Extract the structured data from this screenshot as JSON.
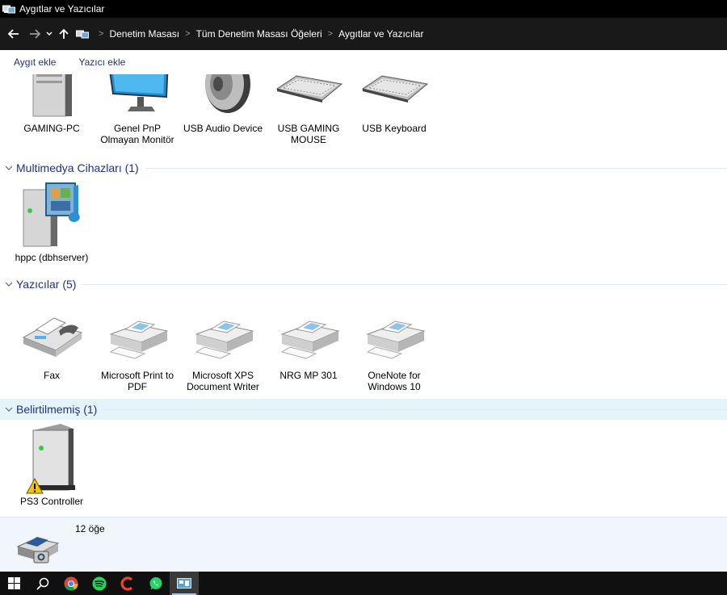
{
  "window": {
    "title": "Aygıtlar ve Yazıcılar"
  },
  "address_bar": {
    "breadcrumbs": [
      "Denetim Masası",
      "Tüm Denetim Masası Öğeleri",
      "Aygıtlar ve Yazıcılar"
    ]
  },
  "toolbar": {
    "add_device_label": "Aygıt ekle",
    "add_printer_label": "Yazıcı ekle"
  },
  "devices": {
    "items": [
      {
        "label": "GAMING-PC",
        "icon": "computer-icon"
      },
      {
        "label": "Genel PnP Olmayan Monitör",
        "icon": "monitor-icon"
      },
      {
        "label": "USB Audio Device",
        "icon": "speaker-icon"
      },
      {
        "label": "USB GAMING MOUSE",
        "icon": "keyboard-icon"
      },
      {
        "label": "USB Keyboard",
        "icon": "keyboard-icon"
      }
    ]
  },
  "groups": {
    "multimedia": {
      "title": "Multimedya Cihazları (1)",
      "items": [
        {
          "label": "hppc (dbhserver)",
          "icon": "media-server-icon"
        }
      ]
    },
    "printers": {
      "title": "Yazıcılar (5)",
      "items": [
        {
          "label": "Fax",
          "icon": "fax-icon"
        },
        {
          "label": "Microsoft Print to PDF",
          "icon": "printer-icon"
        },
        {
          "label": "Microsoft XPS Document Writer",
          "icon": "printer-icon"
        },
        {
          "label": "NRG MP 301",
          "icon": "printer-icon"
        },
        {
          "label": "OneNote for Windows 10",
          "icon": "printer-icon"
        }
      ]
    },
    "unspecified": {
      "title": "Belirtilmemiş (1)",
      "items": [
        {
          "label": "PS3 Controller",
          "icon": "warning-device-icon"
        }
      ]
    }
  },
  "details_pane": {
    "count": "12 öğe"
  },
  "taskbar": {
    "items": [
      "start-icon",
      "search-icon",
      "chrome-icon",
      "spotify-icon",
      "ccleaner-icon",
      "whatsapp-icon",
      "control-panel-icon"
    ]
  },
  "colors": {
    "group_title": "#1e3287",
    "selected_group_bg": "#e5f3fb",
    "titlebar_bg": "#000000",
    "taskbar_bg": "#101010"
  }
}
